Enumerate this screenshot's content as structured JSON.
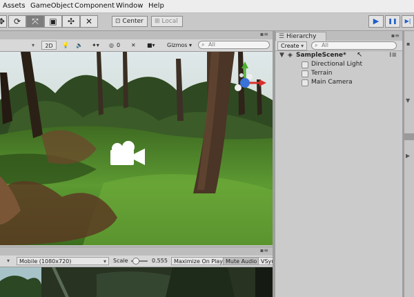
{
  "menu": [
    "Assets",
    "GameObject",
    "Component",
    "Window",
    "Help"
  ],
  "toolbar": {
    "tools": [
      "hand-tool-icon",
      "rotate-tool-icon",
      "scale-tool-icon",
      "rect-tool-icon",
      "transform-tool-icon",
      "custom-tool-icon"
    ],
    "pivot_label": "Center",
    "space_label": "Local",
    "play_icon": "▶",
    "pause_icon": "❚❚",
    "step_icon": "▶|"
  },
  "scene": {
    "mode_2d": "2D",
    "fx_count": "0",
    "gizmos_label": "Gizmos",
    "search_placeholder": "All",
    "search_icon": "⌕"
  },
  "game": {
    "resolution": "Mobile (1080x720)",
    "scale_label": "Scale",
    "scale_value": "0.555",
    "maximize_label": "Maximize On Play",
    "mute_label": "Mute Audio",
    "vsync_label": "VSyr"
  },
  "hierarchy": {
    "tab_label": "Hierarchy",
    "create_label": "Create",
    "search_placeholder": "All",
    "scene_name": "SampleScene*",
    "items": [
      "Directional Light",
      "Terrain",
      "Main Camera"
    ]
  },
  "colors": {
    "play_blue": "#1f5fc8",
    "grass": "#4f8a2a",
    "panel_bg": "#cbcbcb"
  }
}
